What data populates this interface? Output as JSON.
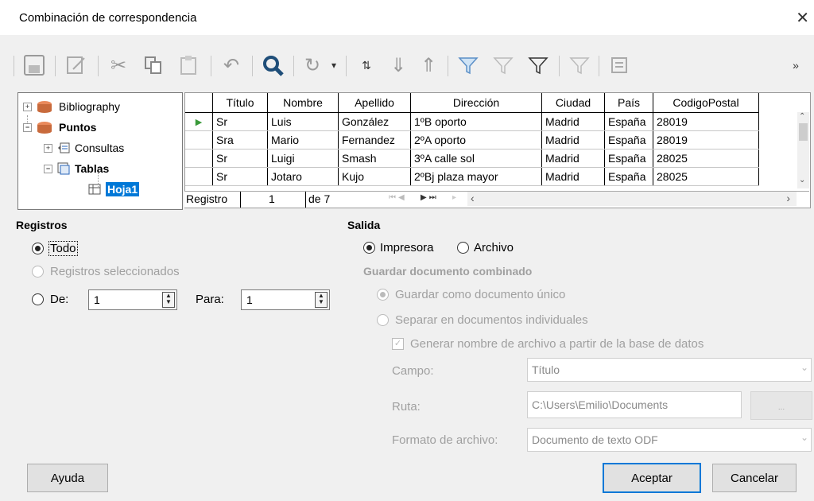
{
  "window": {
    "title": "Combinación de correspondencia",
    "close": "✕"
  },
  "toolbar": {
    "more": "»"
  },
  "tree": [
    {
      "label": "Bibliography",
      "bold": false
    },
    {
      "label": "Puntos",
      "bold": true
    },
    {
      "label": "Consultas",
      "bold": false
    },
    {
      "label": "Tablas",
      "bold": true
    },
    {
      "label": "Hoja1",
      "bold": true
    }
  ],
  "grid": {
    "columns": [
      "Título",
      "Nombre",
      "Apellido",
      "Dirección",
      "Ciudad",
      "País",
      "CodigoPostal"
    ],
    "rows": [
      [
        "Sr",
        "Luis",
        "González",
        "1ºB oporto",
        "Madrid",
        "España",
        "28019"
      ],
      [
        "Sra",
        "Mario",
        "Fernandez",
        "2ºA oporto",
        "Madrid",
        "España",
        "28019"
      ],
      [
        "Sr",
        "Luigi",
        "Smash",
        "3ºA calle sol",
        "Madrid",
        "España",
        "28025"
      ],
      [
        "Sr",
        "Jotaro",
        "Kujo",
        "2ºBj plaza mayor",
        "Madrid",
        "España",
        "28025"
      ]
    ],
    "nav": {
      "registro_label": "Registro",
      "current": "1",
      "total": "de 7"
    }
  },
  "registros": {
    "title": "Registros",
    "todo": "Todo",
    "seleccionados": "Registros seleccionados",
    "de_label": "De:",
    "de_value": "1",
    "para_label": "Para:",
    "para_value": "1"
  },
  "salida": {
    "title": "Salida",
    "impresora": "Impresora",
    "archivo": "Archivo",
    "guardar_title": "Guardar documento combinado",
    "guardar_unico": "Guardar como documento único",
    "separar": "Separar en documentos individuales",
    "generar": "Generar nombre de archivo a partir de la base de datos",
    "campo_label": "Campo:",
    "campo_value": "Título",
    "ruta_label": "Ruta:",
    "ruta_value": "C:\\Users\\Emilio\\Documents",
    "ruta_btn": "...",
    "formato_label": "Formato de archivo:",
    "formato_value": "Documento de texto ODF"
  },
  "buttons": {
    "ayuda": "Ayuda",
    "aceptar": "Aceptar",
    "cancelar": "Cancelar"
  }
}
